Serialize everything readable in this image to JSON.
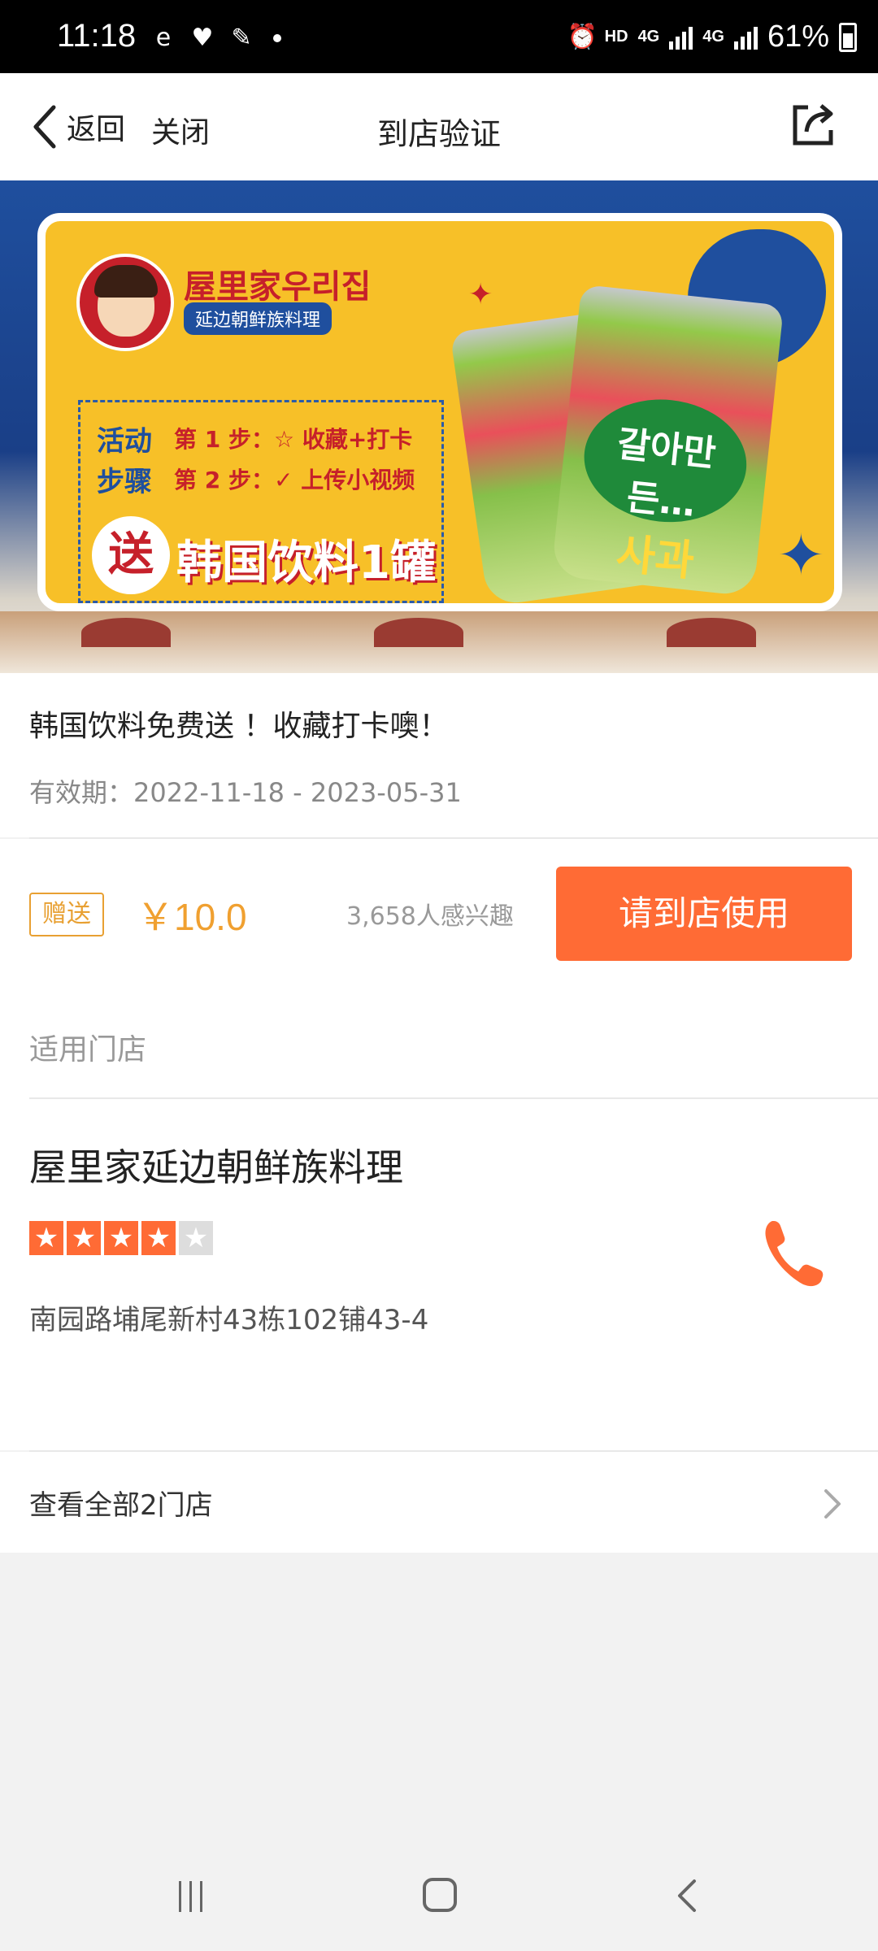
{
  "status_bar": {
    "time": "11:18",
    "network": "HD",
    "network2": "4G",
    "network3": "4G",
    "battery": "61%"
  },
  "titlebar": {
    "back_label": "返回",
    "close_label": "关闭",
    "title": "到店验证"
  },
  "banner": {
    "brand": "屋里家우리집",
    "brand_sub": "延边朝鲜族料理",
    "step_label_1": "活动",
    "step_label_2": "步骤",
    "step1": "第 1 步：☆ 收藏+打卡",
    "step2": "第 2 步：✓ 上传小视频",
    "gift_char": "送",
    "gift_text": "韩国饮料1罐",
    "can_text_1": "갈아만든…",
    "can_text_2": "사과"
  },
  "info": {
    "title": "韩国饮料免费送 ！收藏打卡噢！",
    "validity": "有效期：2022-11-18 - 2023-05-31"
  },
  "price": {
    "badge": "赠送",
    "amount": "￥10.0",
    "interest": "3,658人感兴趣",
    "button": "请到店使用"
  },
  "stores": {
    "header": "适用门店",
    "name": "屋里家延边朝鲜族料理",
    "rating": 4,
    "rating_max": 5,
    "address": "南园路埔尾新村43栋102铺43-4",
    "view_all": "查看全部2门店"
  },
  "colors": {
    "accent": "#ff6b35",
    "price": "#f0a030"
  }
}
